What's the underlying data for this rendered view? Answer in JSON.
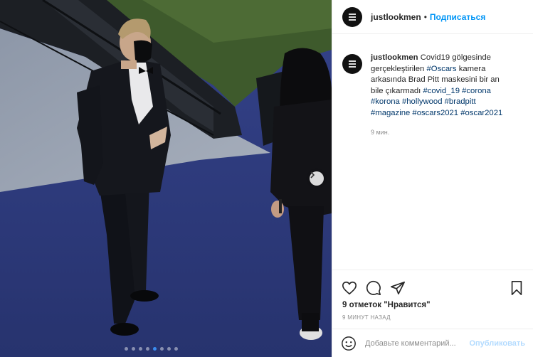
{
  "post": {
    "username": "justlookmen",
    "follow_label": "Подписаться",
    "bullet": "•",
    "caption_prefix": "Covid19 gölgesinde gerçekleştirilen",
    "caption_tag_oscars": "#Oscars",
    "caption_mid": "kamera arkasında Brad Pitt maskesini bir an bile çıkarmadı",
    "tags": [
      "#covid_19",
      "#corona",
      "#korona",
      "#hollywood",
      "#bradpitt",
      "#magazine",
      "#oscars2021",
      "#oscar2021"
    ],
    "caption_time": "9 мин.",
    "likes_count": "9 отметок",
    "likes_word": "\"Нравится\"",
    "posted_time": "9 МИНУТ НАЗАД"
  },
  "comment_box": {
    "placeholder": "Добавьте комментарий...",
    "publish_label": "Опубликовать"
  },
  "carousel": {
    "slide_count": 8,
    "active_index": 4
  },
  "icons": {
    "like": "heart-icon",
    "comment": "comment-icon",
    "share": "paper-plane-icon",
    "save": "bookmark-icon",
    "emoji": "smiley-icon",
    "next": "chevron-right-icon"
  },
  "colors": {
    "link": "#00376b",
    "follow": "#0095f6",
    "publish_disabled": "#b3dbff",
    "carpet": "#2c3a7a"
  }
}
